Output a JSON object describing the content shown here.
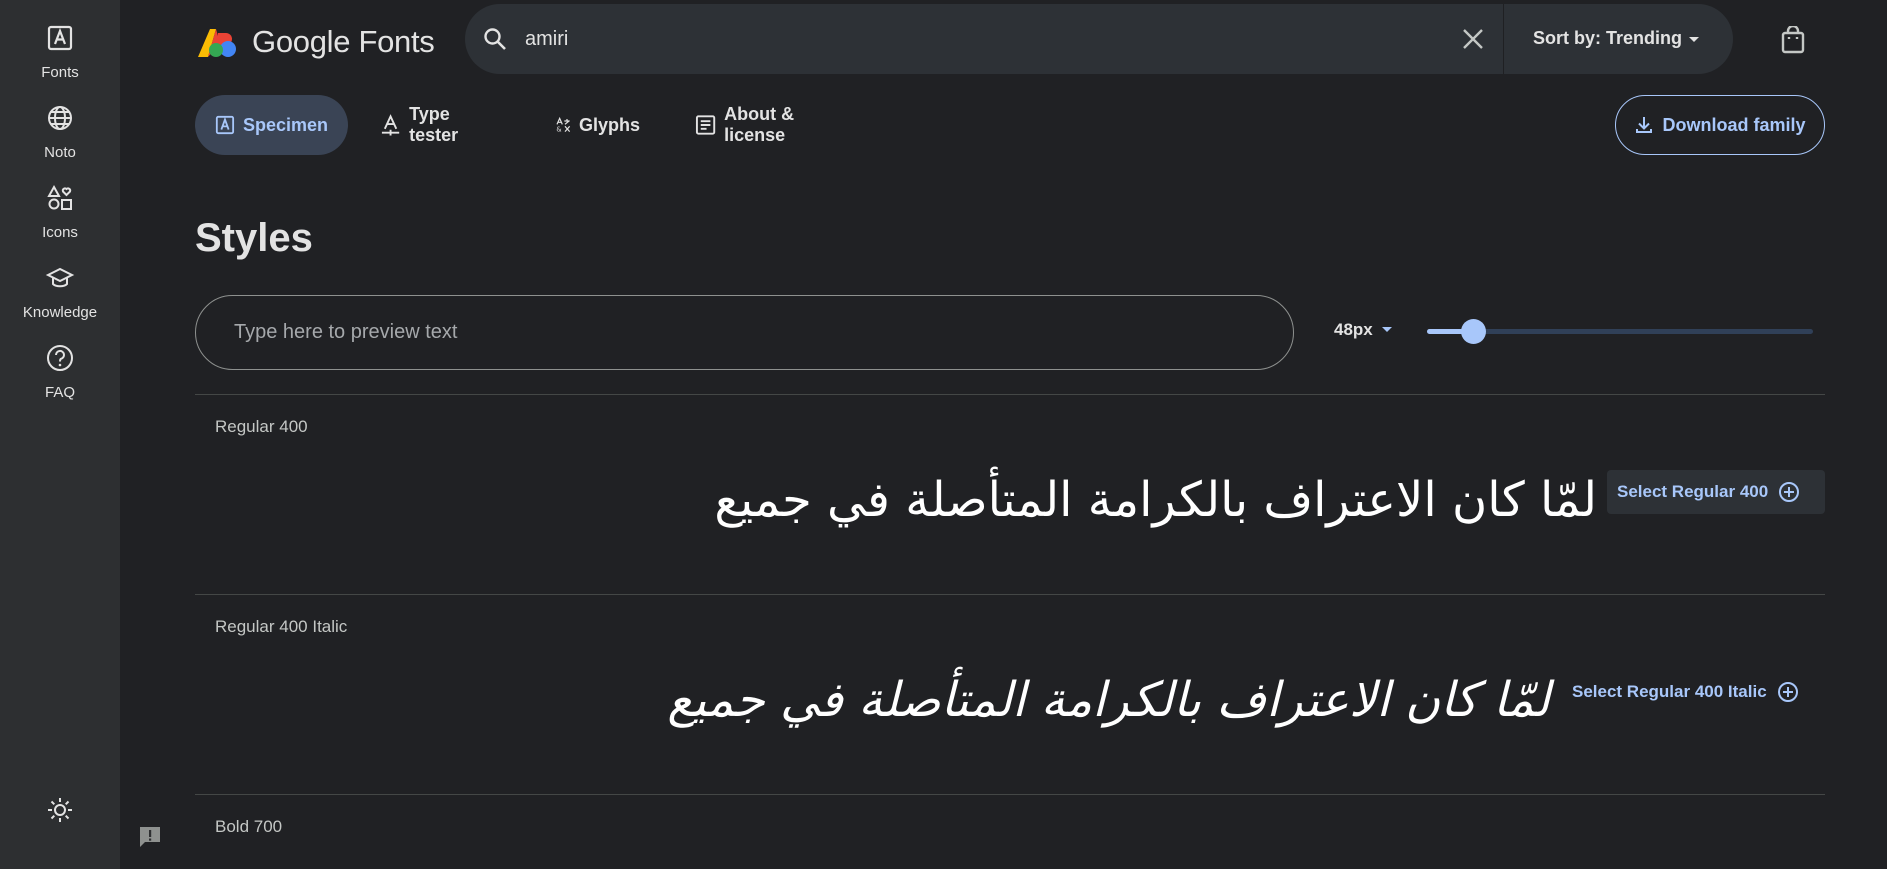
{
  "rail": {
    "items": [
      {
        "label": "Fonts"
      },
      {
        "label": "Noto"
      },
      {
        "label": "Icons"
      },
      {
        "label": "Knowledge"
      },
      {
        "label": "FAQ"
      }
    ]
  },
  "header": {
    "logo_text": "Google Fonts",
    "search_value": "amiri",
    "sort_label": "Sort by: Trending"
  },
  "tabs": [
    {
      "label": "Specimen",
      "active": true
    },
    {
      "label": "Type tester",
      "active": false
    },
    {
      "label": "Glyphs",
      "active": false
    },
    {
      "label": "About & license",
      "active": false
    }
  ],
  "download_label": "Download family",
  "styles": {
    "title": "Styles",
    "preview_placeholder": "Type here to preview text",
    "size_label": "48px",
    "size_slider_fraction": 0.12,
    "sample_text": "لمّا كان الاعتراف بالكرامة المتأصلة في جميع",
    "variants": [
      {
        "label": "Regular 400",
        "select_label": "Select Regular 400"
      },
      {
        "label": "Regular 400 Italic",
        "select_label": "Select Regular 400 Italic"
      },
      {
        "label": "Bold 700"
      }
    ]
  },
  "colors": {
    "background": "#202124",
    "rail": "#2d2f31",
    "accent": "#a8c7fa",
    "active_tab": "#3a4455"
  }
}
